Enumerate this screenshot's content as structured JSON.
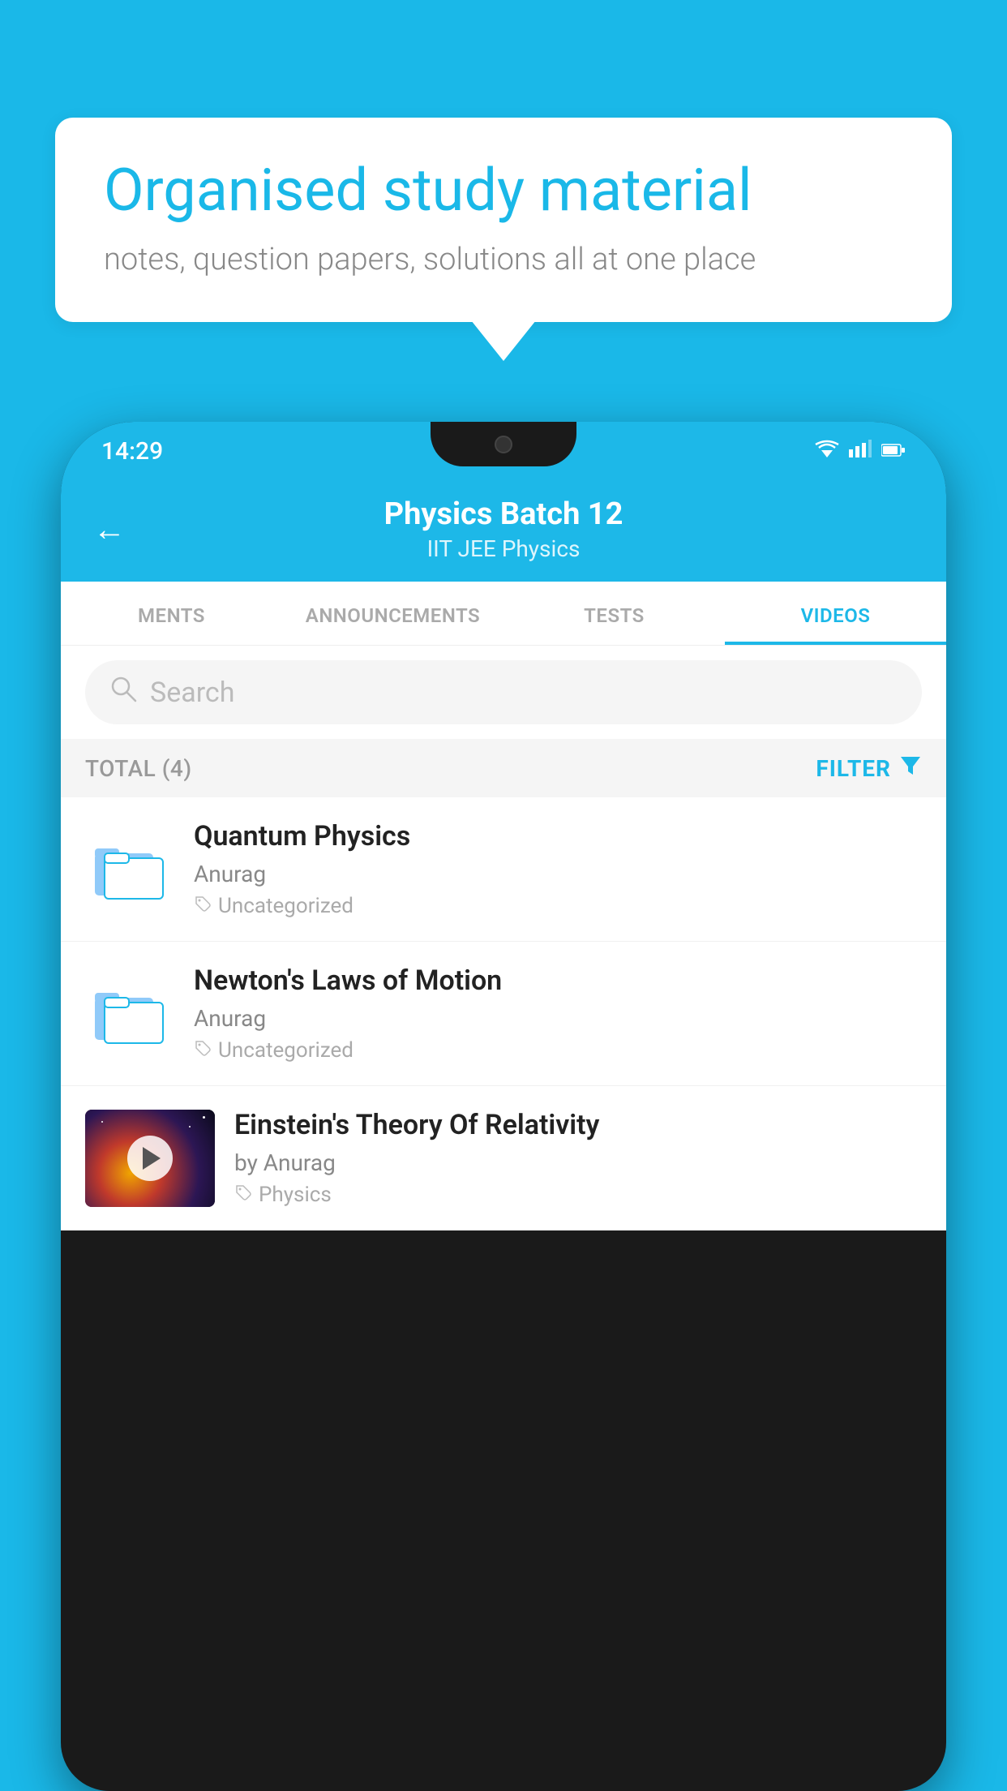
{
  "background_color": "#1ab8e8",
  "speech_bubble": {
    "heading": "Organised study material",
    "subtext": "notes, question papers, solutions all at one place"
  },
  "status_bar": {
    "time": "14:29",
    "wifi": "▾",
    "signal": "▲",
    "battery": "▮"
  },
  "app_header": {
    "back_label": "←",
    "title": "Physics Batch 12",
    "subtitle_tags": "IIT JEE   Physics"
  },
  "tabs": [
    {
      "label": "MENTS",
      "active": false
    },
    {
      "label": "ANNOUNCEMENTS",
      "active": false
    },
    {
      "label": "TESTS",
      "active": false
    },
    {
      "label": "VIDEOS",
      "active": true
    }
  ],
  "search": {
    "placeholder": "Search"
  },
  "filter_row": {
    "total_label": "TOTAL (4)",
    "filter_label": "FILTER"
  },
  "videos": [
    {
      "id": 1,
      "title": "Quantum Physics",
      "author": "Anurag",
      "tag": "Uncategorized",
      "has_thumbnail": false
    },
    {
      "id": 2,
      "title": "Newton's Laws of Motion",
      "author": "Anurag",
      "tag": "Uncategorized",
      "has_thumbnail": false
    },
    {
      "id": 3,
      "title": "Einstein's Theory Of Relativity",
      "author": "by Anurag",
      "tag": "Physics",
      "has_thumbnail": true
    }
  ]
}
